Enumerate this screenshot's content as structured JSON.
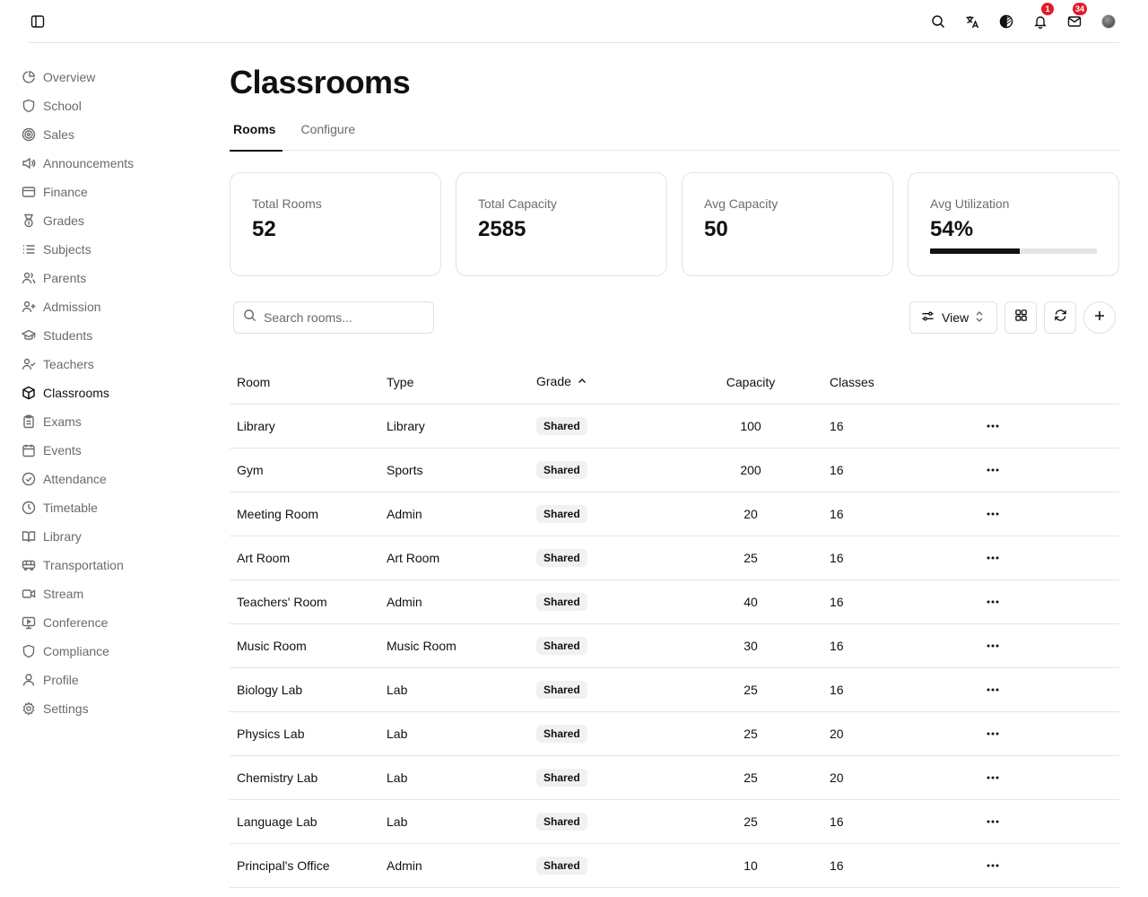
{
  "page": {
    "title": "Classrooms"
  },
  "header": {
    "notifications_count": "1",
    "messages_count": "34"
  },
  "sidebar": {
    "items": [
      {
        "label": "Overview",
        "icon": "chart-pie-icon"
      },
      {
        "label": "School",
        "icon": "shield-icon"
      },
      {
        "label": "Sales",
        "icon": "target-icon"
      },
      {
        "label": "Announcements",
        "icon": "megaphone-icon"
      },
      {
        "label": "Finance",
        "icon": "credit-card-icon"
      },
      {
        "label": "Grades",
        "icon": "medal-icon"
      },
      {
        "label": "Subjects",
        "icon": "list-icon"
      },
      {
        "label": "Parents",
        "icon": "users-icon"
      },
      {
        "label": "Admission",
        "icon": "user-plus-icon"
      },
      {
        "label": "Students",
        "icon": "graduation-cap-icon"
      },
      {
        "label": "Teachers",
        "icon": "user-check-icon"
      },
      {
        "label": "Classrooms",
        "icon": "box-icon",
        "active": true
      },
      {
        "label": "Exams",
        "icon": "clipboard-icon"
      },
      {
        "label": "Events",
        "icon": "calendar-icon"
      },
      {
        "label": "Attendance",
        "icon": "check-circle-icon"
      },
      {
        "label": "Timetable",
        "icon": "clock-icon"
      },
      {
        "label": "Library",
        "icon": "book-open-icon"
      },
      {
        "label": "Transportation",
        "icon": "bus-icon"
      },
      {
        "label": "Stream",
        "icon": "video-icon"
      },
      {
        "label": "Conference",
        "icon": "monitor-play-icon"
      },
      {
        "label": "Compliance",
        "icon": "shield-icon"
      },
      {
        "label": "Profile",
        "icon": "user-icon"
      },
      {
        "label": "Settings",
        "icon": "gear-icon"
      }
    ]
  },
  "tabs": [
    {
      "label": "Rooms",
      "active": true
    },
    {
      "label": "Configure",
      "active": false
    }
  ],
  "stats": [
    {
      "label": "Total Rooms",
      "value": "52"
    },
    {
      "label": "Total Capacity",
      "value": "2585"
    },
    {
      "label": "Avg Capacity",
      "value": "50"
    },
    {
      "label": "Avg Utilization",
      "value": "54%",
      "progress": 0.54
    }
  ],
  "toolbar": {
    "search_placeholder": "Search rooms...",
    "view_label": "View"
  },
  "table": {
    "columns": [
      "Room",
      "Type",
      "Grade",
      "Capacity",
      "Classes"
    ],
    "sorted_column": "Grade",
    "rows": [
      {
        "room": "Library",
        "type": "Library",
        "grade": "Shared",
        "capacity": "100",
        "classes": "16"
      },
      {
        "room": "Gym",
        "type": "Sports",
        "grade": "Shared",
        "capacity": "200",
        "classes": "16"
      },
      {
        "room": "Meeting Room",
        "type": "Admin",
        "grade": "Shared",
        "capacity": "20",
        "classes": "16"
      },
      {
        "room": "Art Room",
        "type": "Art Room",
        "grade": "Shared",
        "capacity": "25",
        "classes": "16"
      },
      {
        "room": "Teachers' Room",
        "type": "Admin",
        "grade": "Shared",
        "capacity": "40",
        "classes": "16"
      },
      {
        "room": "Music Room",
        "type": "Music Room",
        "grade": "Shared",
        "capacity": "30",
        "classes": "16"
      },
      {
        "room": "Biology Lab",
        "type": "Lab",
        "grade": "Shared",
        "capacity": "25",
        "classes": "16"
      },
      {
        "room": "Physics Lab",
        "type": "Lab",
        "grade": "Shared",
        "capacity": "25",
        "classes": "20"
      },
      {
        "room": "Chemistry Lab",
        "type": "Lab",
        "grade": "Shared",
        "capacity": "25",
        "classes": "20"
      },
      {
        "room": "Language Lab",
        "type": "Lab",
        "grade": "Shared",
        "capacity": "25",
        "classes": "16"
      },
      {
        "room": "Principal's Office",
        "type": "Admin",
        "grade": "Shared",
        "capacity": "10",
        "classes": "16"
      }
    ]
  }
}
